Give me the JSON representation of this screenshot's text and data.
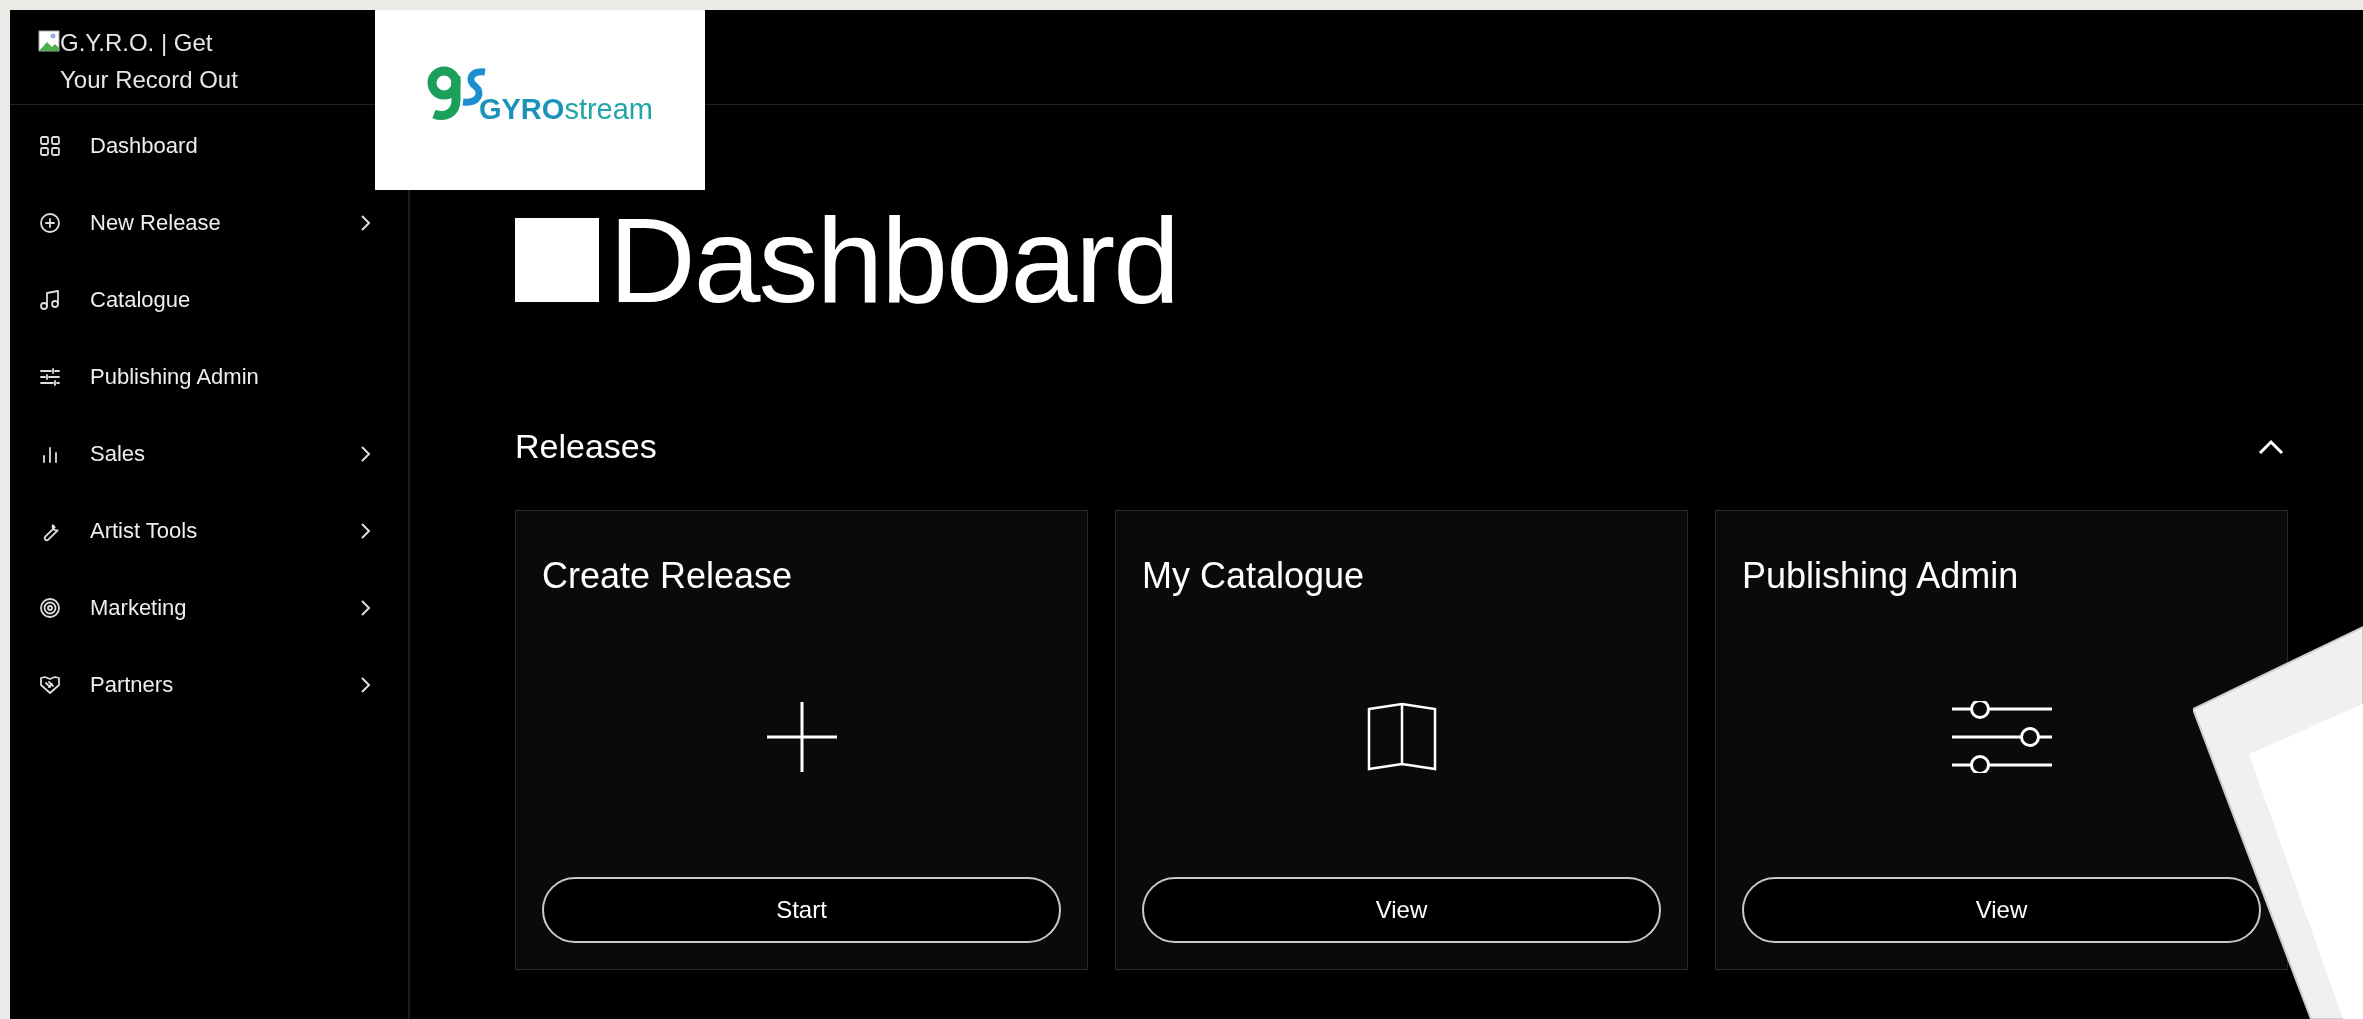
{
  "brand": {
    "alt_text": "G.Y.R.O. | Get Your Record Out"
  },
  "logo": {
    "part_1": "GYRO",
    "part_2": "stream"
  },
  "sidebar": {
    "items": [
      {
        "label": "Dashboard",
        "has_submenu": false
      },
      {
        "label": "New Release",
        "has_submenu": true
      },
      {
        "label": "Catalogue",
        "has_submenu": false
      },
      {
        "label": "Publishing Admin",
        "has_submenu": false
      },
      {
        "label": "Sales",
        "has_submenu": true
      },
      {
        "label": "Artist Tools",
        "has_submenu": true
      },
      {
        "label": "Marketing",
        "has_submenu": true
      },
      {
        "label": "Partners",
        "has_submenu": true
      }
    ]
  },
  "page": {
    "title": "Dashboard"
  },
  "section": {
    "title": "Releases",
    "expanded": true,
    "cards": [
      {
        "title": "Create Release",
        "button": "Start"
      },
      {
        "title": "My Catalogue",
        "button": "View"
      },
      {
        "title": "Publishing Admin",
        "button": "View"
      }
    ]
  }
}
